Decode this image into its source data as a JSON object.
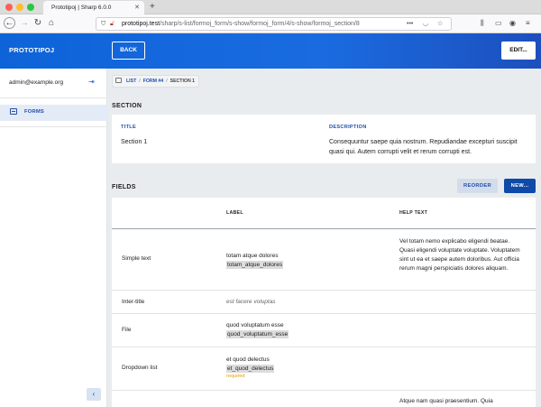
{
  "browser": {
    "tab_title": "Prototipoj | Sharp 6.0.0",
    "url_host": "prototipoj.test",
    "url_path": "/sharp/s-list/formoj_form/s-show/formoj_form/4/s-show/formoj_section/8"
  },
  "header": {
    "brand": "PROTOTIPOJ",
    "back_label": "BACK",
    "edit_label": "EDIT..."
  },
  "sidebar": {
    "user_email": "admin@example.org",
    "items": [
      {
        "label": "FORMS",
        "icon": "forms-icon"
      }
    ]
  },
  "breadcrumb": {
    "items": [
      "LIST",
      "FORM #4",
      "SECTION 1"
    ]
  },
  "section": {
    "heading": "SECTION",
    "title_label": "TITLE",
    "title_value": "Section 1",
    "description_label": "DESCRIPTION",
    "description_value": "Consequuntur saepe quia nostrum. Repudiandae excepturi suscipit quasi qui. Autem corrupti velit et rerum corrupti est."
  },
  "fields": {
    "heading": "FIELDS",
    "reorder_label": "REORDER",
    "new_label": "NEW...",
    "columns": [
      "LABEL",
      "HELP TEXT"
    ],
    "rows": [
      {
        "type": "Simple text",
        "label": "totam atque dolores",
        "key": "totam_atque_dolores",
        "required": "",
        "help": "Vel totam nemo explicabo eligendi beatae. Quasi eligendi voluptate voluptate. Voluptatem sint ut ea et saepe autem doloribus. Aut officia rerum magni perspiciatis dolores aliquam."
      },
      {
        "type": "Inter-title",
        "label": "est facere voluptas",
        "key": "",
        "required": "",
        "help": ""
      },
      {
        "type": "File",
        "label": "quod voluptatum esse",
        "key": "quod_voluptatum_esse",
        "required": "",
        "help": ""
      },
      {
        "type": "Dropdown list",
        "label": "et quod delectus",
        "key": "et_quod_delectus",
        "required": "required",
        "help": ""
      },
      {
        "type": "",
        "label": "",
        "key": "",
        "required": "",
        "help": "Atque nam quasi praesentium. Quia"
      }
    ]
  }
}
